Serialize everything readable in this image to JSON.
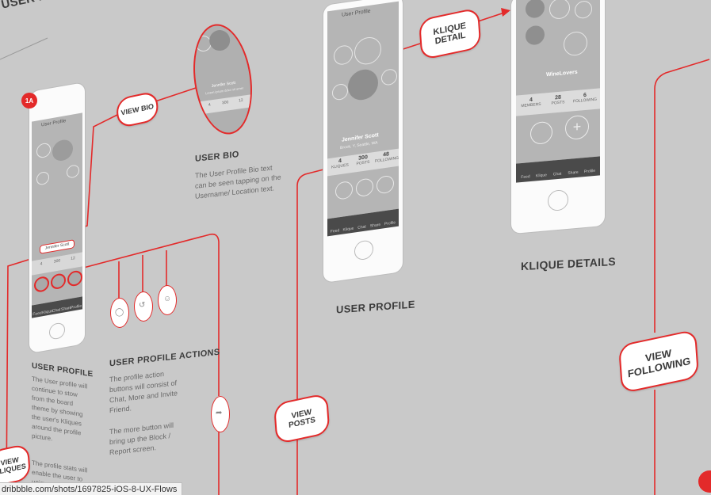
{
  "page": {
    "section_title": "USER PRO",
    "badge": "1A",
    "status_url": "dribbble.com/shots/1697825-iOS-8-UX-Flows"
  },
  "screens": {
    "small_profile": {
      "nav_title": "User Profile",
      "name_tag": "Jennifer Scott",
      "stats": [
        "4",
        "300",
        "12"
      ],
      "tabs": [
        "Feed",
        "Klique",
        "Chat",
        "Share",
        "Profile"
      ]
    },
    "bio_zoom": {
      "name": "Jennifer Scott",
      "bio": "Lorem ipsum dolor sit amet",
      "stats": [
        "4",
        "300",
        "12"
      ]
    },
    "user_profile": {
      "nav_title": "User Profile",
      "name": "Jennifer Scott",
      "location": "Brook, Y, Seattle, WA",
      "stats": [
        {
          "value": "4",
          "label": "KLIQUES"
        },
        {
          "value": "300",
          "label": "POSTS"
        },
        {
          "value": "48",
          "label": "FOLLOWING"
        }
      ],
      "tabs": [
        "Feed",
        "Klique",
        "Chat",
        "Share",
        "Profile"
      ]
    },
    "klique_detail": {
      "title": "WineLovers",
      "stats": [
        {
          "value": "4",
          "label": "MEMBERS"
        },
        {
          "value": "28",
          "label": "POSTS"
        },
        {
          "value": "6",
          "label": "FOLLOWING"
        }
      ],
      "tabs": [
        "Feed",
        "Klique",
        "Chat",
        "Share",
        "Profile"
      ]
    }
  },
  "labels": {
    "user_profile_1": "USER PROFILE",
    "user_profile_actions": "USER PROFILE ACTIONS",
    "user_bio": "USER BIO",
    "user_profile_2": "USER PROFILE",
    "klique_details": "KLIQUE DETAILS"
  },
  "descriptions": {
    "user_profile": "The User profile will continue to stow from the board theme by showing the user's Kliques around the profile picture.",
    "user_profile_more": "The profile stats will enable the user to unique",
    "actions_1": "The profile action buttons will consist of Chat, More and Invite Friend.",
    "actions_2": "The more button will bring up the Block / Report screen.",
    "bio": "The User Profile Bio text can be seen tapping on the Username/ Location text."
  },
  "buttons": {
    "view_bio": "VIEW BIO",
    "klique_detail_1": "KLIQUE",
    "klique_detail_2": "DETAIL",
    "view_posts_1": "VIEW",
    "view_posts_2": "POSTS",
    "view_following_1": "VIEW",
    "view_following_2": "FOLLOWING",
    "view_kliques_1": "VIEW",
    "view_kliques_2": "KLIQUES"
  },
  "colors": {
    "accent": "#e32a2a",
    "background": "#c9c9c9",
    "phone": "#fbfbfb",
    "screen": "#b5b5b5",
    "tabbar": "#4a4a4a"
  }
}
